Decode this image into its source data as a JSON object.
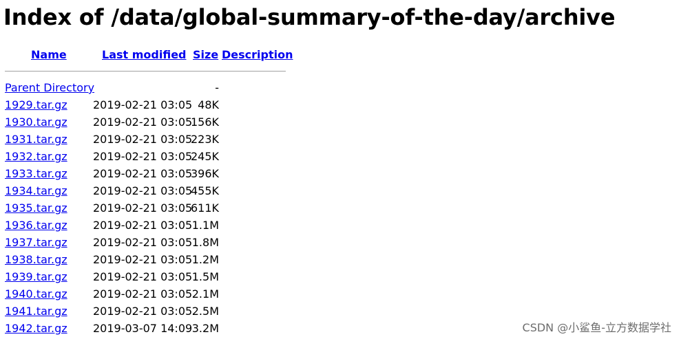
{
  "page": {
    "title": "Index of /data/global-summary-of-the-day/archive"
  },
  "table": {
    "headers": {
      "name": "Name",
      "last_modified": "Last modified",
      "size": "Size",
      "description": "Description"
    },
    "rows": [
      {
        "name": "Parent Directory",
        "modified": "",
        "size": "-"
      },
      {
        "name": "1929.tar.gz",
        "modified": "2019-02-21 03:05",
        "size": "48K"
      },
      {
        "name": "1930.tar.gz",
        "modified": "2019-02-21 03:05",
        "size": "156K"
      },
      {
        "name": "1931.tar.gz",
        "modified": "2019-02-21 03:05",
        "size": "223K"
      },
      {
        "name": "1932.tar.gz",
        "modified": "2019-02-21 03:05",
        "size": "245K"
      },
      {
        "name": "1933.tar.gz",
        "modified": "2019-02-21 03:05",
        "size": "396K"
      },
      {
        "name": "1934.tar.gz",
        "modified": "2019-02-21 03:05",
        "size": "455K"
      },
      {
        "name": "1935.tar.gz",
        "modified": "2019-02-21 03:05",
        "size": "611K"
      },
      {
        "name": "1936.tar.gz",
        "modified": "2019-02-21 03:05",
        "size": "1.1M"
      },
      {
        "name": "1937.tar.gz",
        "modified": "2019-02-21 03:05",
        "size": "1.8M"
      },
      {
        "name": "1938.tar.gz",
        "modified": "2019-02-21 03:05",
        "size": "1.2M"
      },
      {
        "name": "1939.tar.gz",
        "modified": "2019-02-21 03:05",
        "size": "1.5M"
      },
      {
        "name": "1940.tar.gz",
        "modified": "2019-02-21 03:05",
        "size": "2.1M"
      },
      {
        "name": "1941.tar.gz",
        "modified": "2019-02-21 03:05",
        "size": "2.5M"
      },
      {
        "name": "1942.tar.gz",
        "modified": "2019-03-07 14:09",
        "size": "3.2M"
      }
    ]
  },
  "watermark": {
    "text": "CSDN @小鲨鱼-立方数据学社"
  },
  "colors": {
    "link": "#0000ee",
    "text": "#000000",
    "rule": "#a0a0a0",
    "watermark": "#6d6d6d"
  }
}
